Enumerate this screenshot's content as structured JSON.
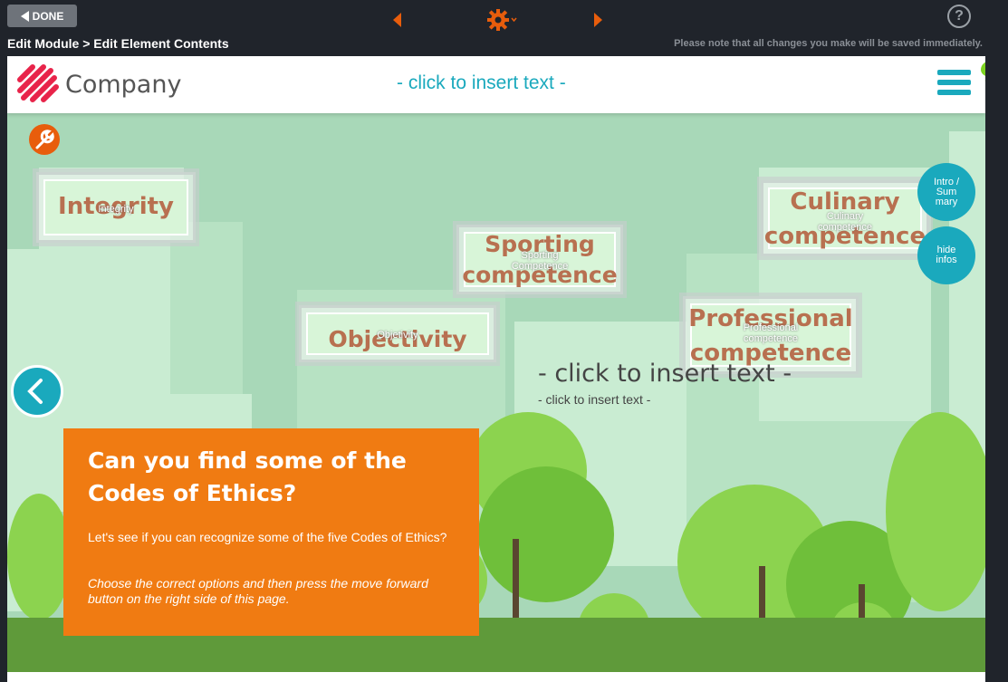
{
  "toolbar": {
    "done_label": "DONE",
    "breadcrumb": "Edit Module > Edit Element Contents",
    "save_note": "Please note that all changes you make will be saved immediately.",
    "help_label": "?"
  },
  "header": {
    "company_name": "Company",
    "insert_text": "- click to insert text -"
  },
  "cards": {
    "integrity": {
      "big": "Integrity",
      "small": "Integrity"
    },
    "sporting": {
      "big_line1": "Sporting",
      "big_line2": "competence",
      "small_line1": "Sporting",
      "small_line2": "Competence"
    },
    "objectivity": {
      "big": "Objectivity",
      "small": "Objetivity"
    },
    "culinary": {
      "big_line1": "Culinary",
      "big_line2": "competence",
      "small_line1": "Culinary",
      "small_line2": "competence"
    },
    "professional": {
      "big_line1": "Professional",
      "big_line2": "competence",
      "small_line1": "Professional",
      "small_line2": "competence"
    }
  },
  "side_buttons": {
    "intro_line1": "Intro /",
    "intro_line2": "Sum",
    "intro_line3": "mary",
    "hide_line1": "hide",
    "hide_line2": "infos"
  },
  "stage_text": {
    "insert_main": "- click to insert text -",
    "insert_sub": "- click to insert text -"
  },
  "info_box": {
    "title": "Can you find some of the Codes of Ethics?",
    "text": "Let's see if you can recognize some of the five Codes of Ethics?",
    "instruction": "Choose the correct options and then press the move forward button on the right side of this page."
  },
  "colors": {
    "accent_teal": "#1aa9bd",
    "accent_orange": "#f07b12",
    "toolbar_bg": "#20242b"
  }
}
